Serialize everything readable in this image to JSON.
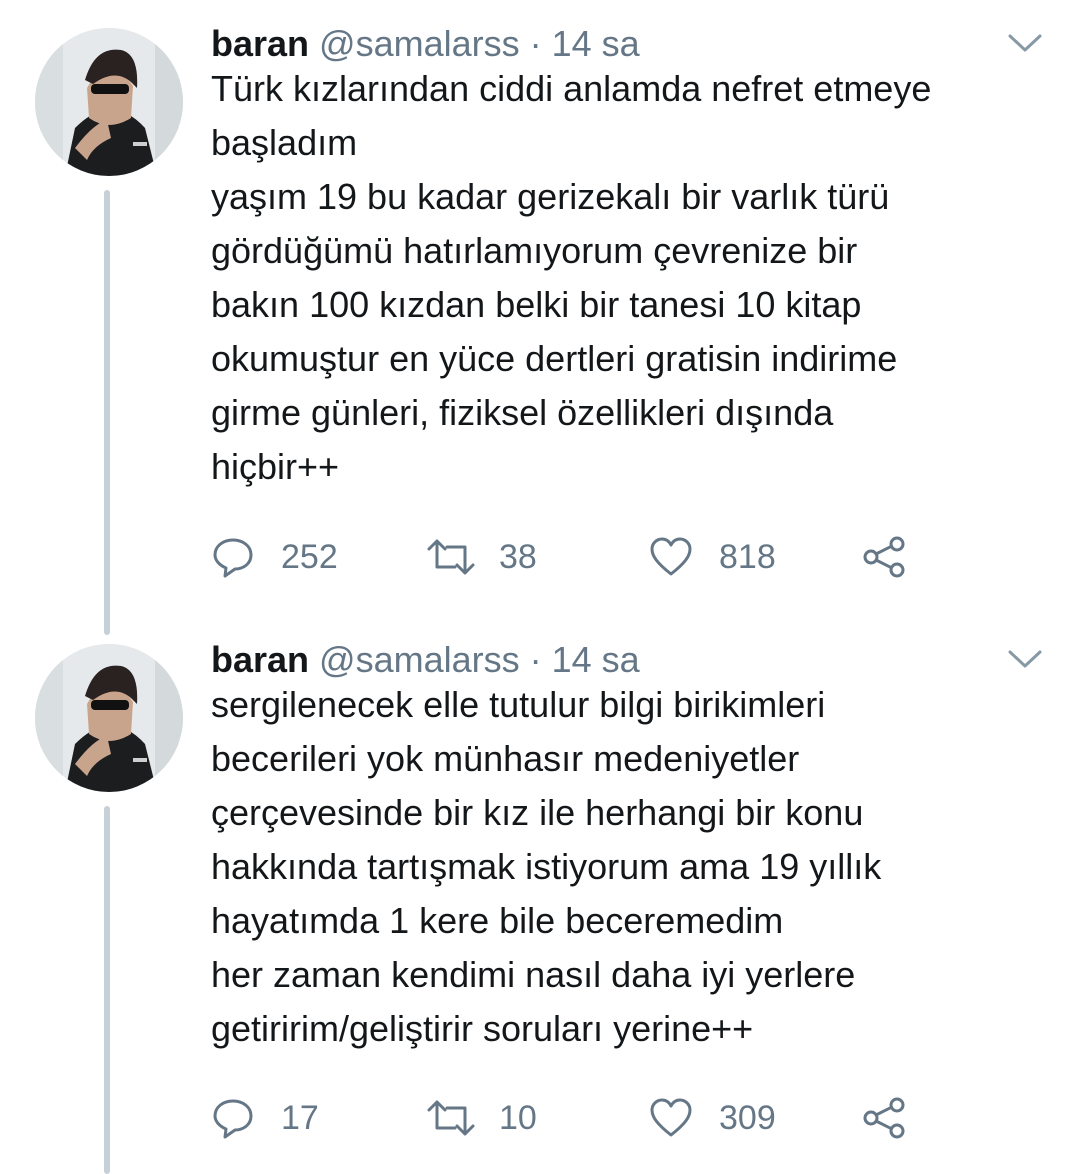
{
  "tweets": [
    {
      "author": {
        "name": "baran",
        "handle": "@samalarss"
      },
      "separator": "·",
      "time": "14 sa",
      "text_lines": [
        "Türk kızlarından ciddi anlamda nefret etmeye",
        "başladım",
        "yaşım 19 bu kadar gerizekalı bir varlık türü",
        "gördüğümü hatırlamıyorum çevrenize bir",
        "bakın 100 kızdan belki bir tanesi 10 kitap",
        "okumuştur en yüce dertleri gratisin indirime",
        "girme günleri, fiziksel özellikleri dışında",
        "hiçbir++"
      ],
      "actions": {
        "replies": "252",
        "retweets": "38",
        "likes": "818"
      }
    },
    {
      "author": {
        "name": "baran",
        "handle": "@samalarss"
      },
      "separator": "·",
      "time": "14 sa",
      "text_lines": [
        "sergilenecek elle tutulur bilgi birikimleri",
        "becerileri yok münhasır medeniyetler",
        "çerçevesinde bir kız ile herhangi bir konu",
        "hakkında tartışmak istiyorum ama 19 yıllık",
        "hayatımda 1 kere bile beceremedim",
        "her zaman kendimi nasıl daha iyi yerlere",
        "getiririm/geliştirir soruları yerine++"
      ],
      "actions": {
        "replies": "17",
        "retweets": "10",
        "likes": "309"
      }
    }
  ],
  "icons": {
    "reply": "reply-icon",
    "retweet": "retweet-icon",
    "like": "heart-icon",
    "share": "share-icon",
    "menu": "chevron-down-icon"
  },
  "colors": {
    "text": "#14171a",
    "secondary": "#657786",
    "thread_line": "#c8d0d7"
  }
}
